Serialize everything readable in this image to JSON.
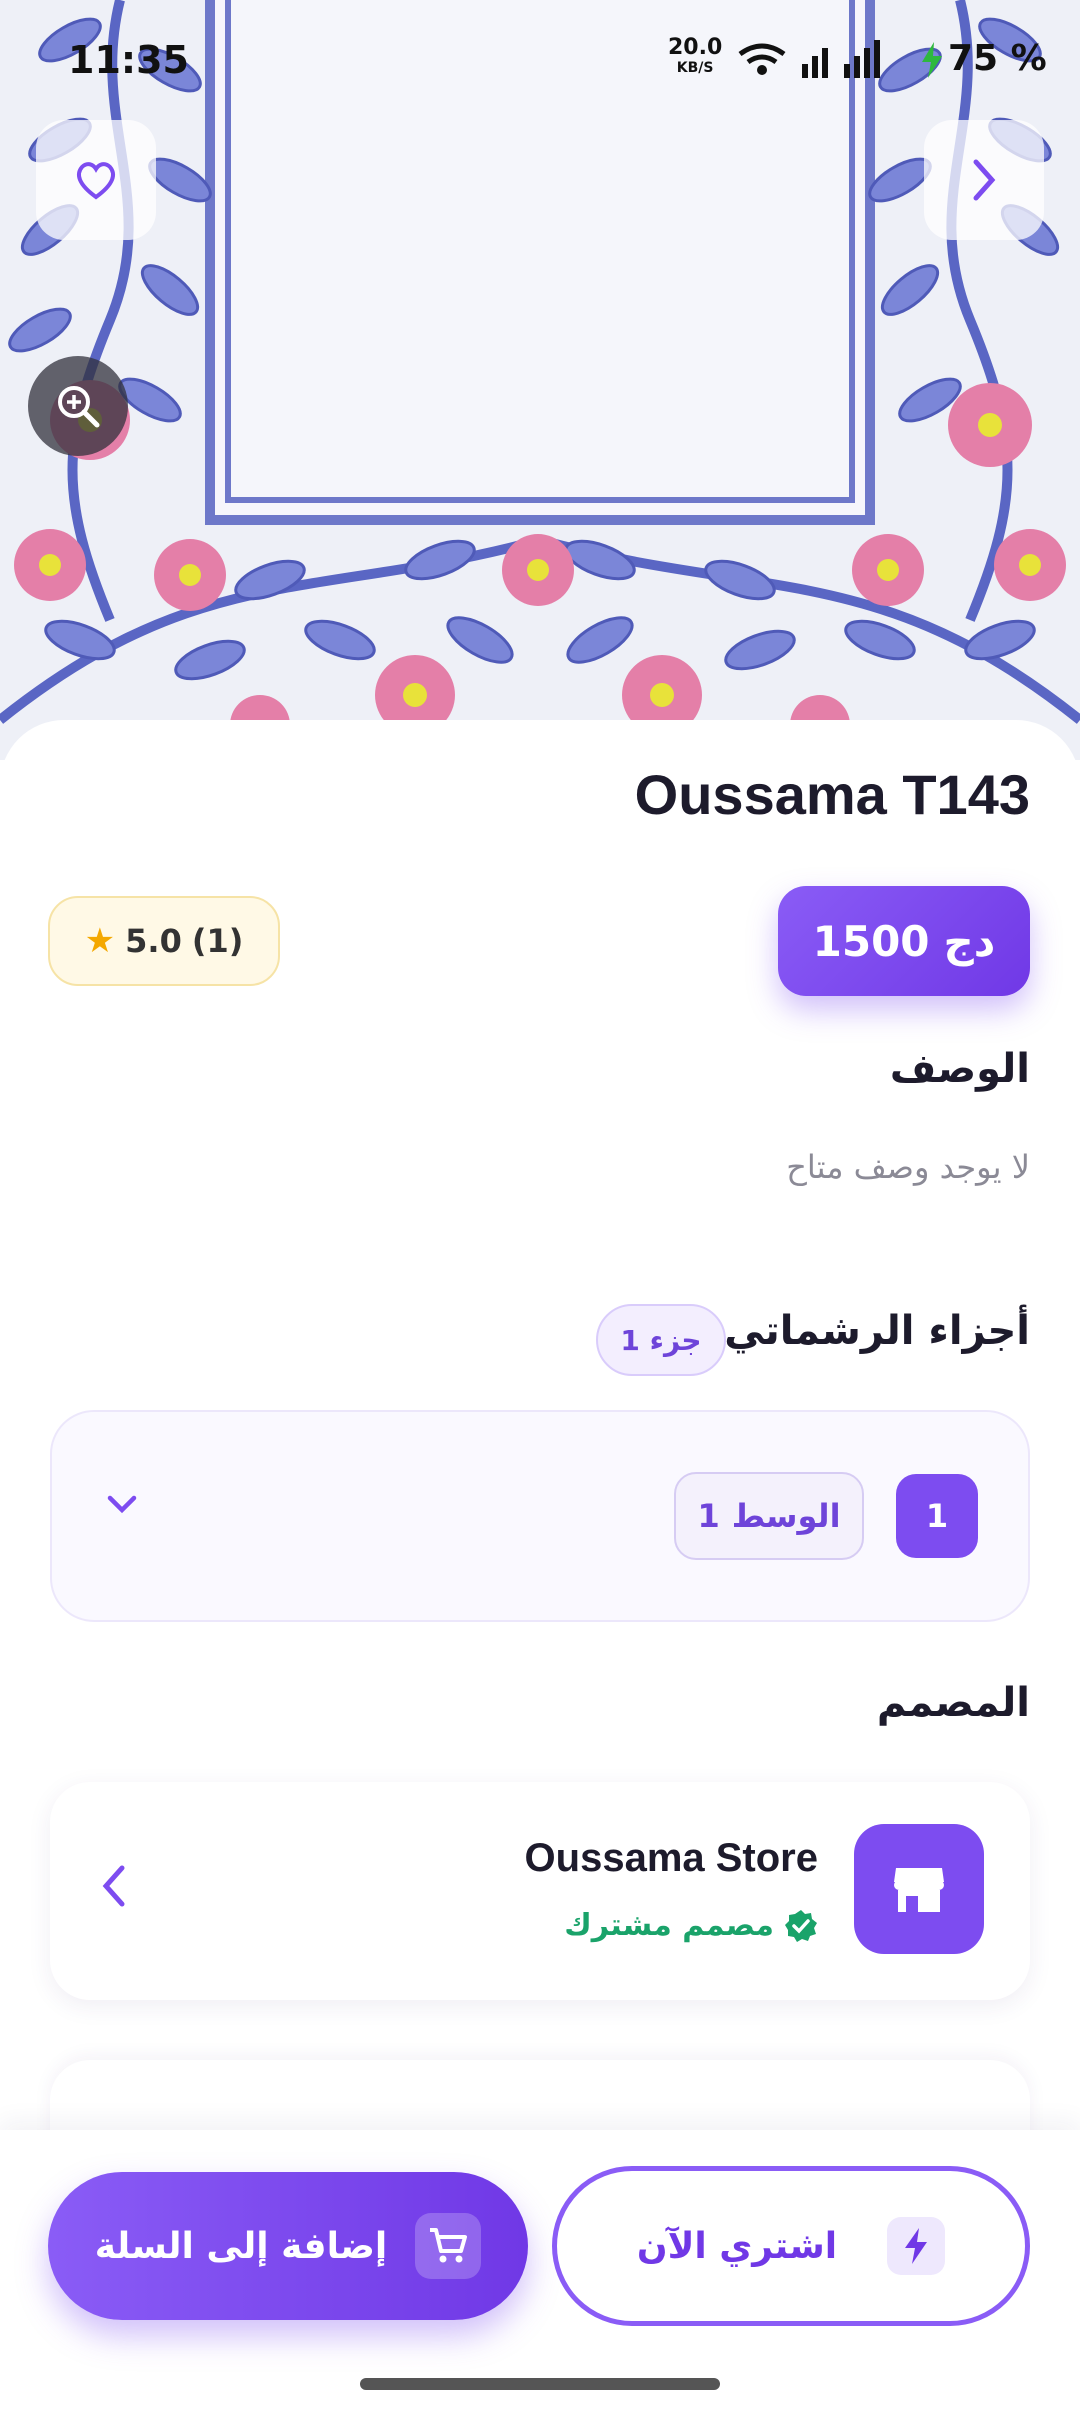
{
  "status_bar": {
    "time": "11:35",
    "net_speed": "20.0",
    "net_unit": "KB/S",
    "battery": "75 %"
  },
  "product": {
    "title": "Oussama T143",
    "price_value": "1500",
    "price_currency": "دج",
    "rating_value": "5.0",
    "rating_count": "(1)"
  },
  "description": {
    "heading": "الوصف",
    "text": "لا يوجد وصف متاح"
  },
  "parts": {
    "heading": "أجزاء الرشماتي",
    "count_badge": "1 جزء",
    "items": [
      {
        "index": "1",
        "label": "الوسط",
        "count": "1"
      }
    ]
  },
  "designer": {
    "heading": "المصمم",
    "name": "Oussama Store",
    "subtitle": "مصمم مشترك"
  },
  "actions": {
    "add_to_cart": "إضافة إلى السلة",
    "buy_now": "اشتري الآن"
  },
  "colors": {
    "accent": "#7d4cf0",
    "verified": "#1aa36a",
    "star": "#f4a800"
  },
  "icons": [
    "heart-icon",
    "chevron-right-icon",
    "zoom-in-icon",
    "chevron-down-icon",
    "store-icon",
    "verified-icon",
    "chevron-left-icon",
    "cart-icon",
    "lightning-icon"
  ]
}
